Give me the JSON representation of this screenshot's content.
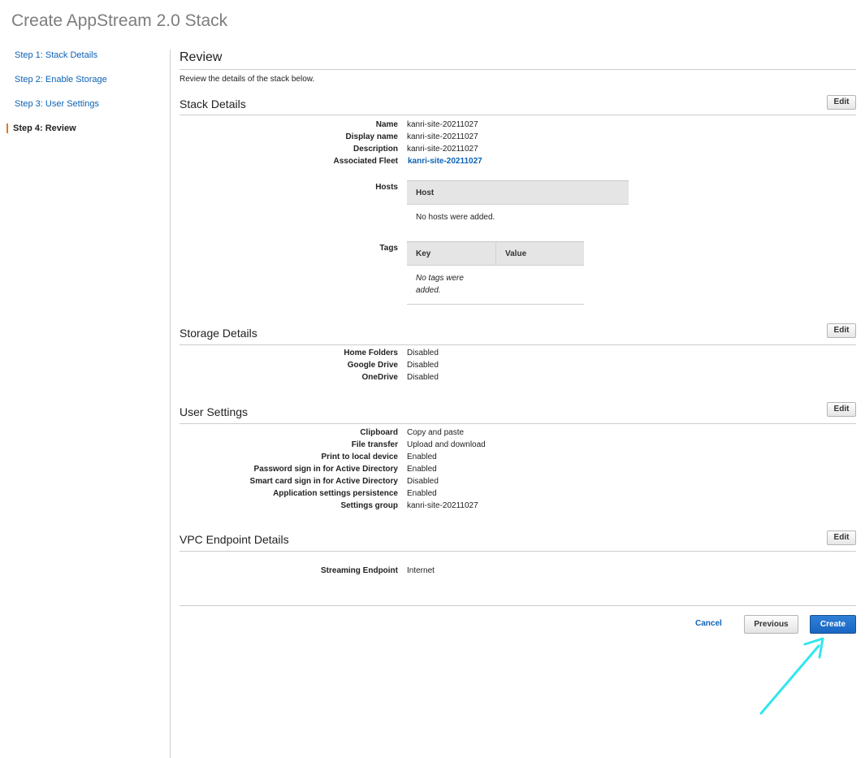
{
  "page": {
    "title": "Create AppStream 2.0 Stack"
  },
  "steps": [
    {
      "label": "Step 1: Stack Details",
      "active": false
    },
    {
      "label": "Step 2: Enable Storage",
      "active": false
    },
    {
      "label": "Step 3: User Settings",
      "active": false
    },
    {
      "label": "Step 4: Review",
      "active": true
    }
  ],
  "review": {
    "title": "Review",
    "description": "Review the details of the stack below."
  },
  "stack_details": {
    "title": "Stack Details",
    "edit_label": "Edit",
    "name": {
      "label": "Name",
      "value": "kanri-site-20211027"
    },
    "display_name": {
      "label": "Display name",
      "value": "kanri-site-20211027"
    },
    "description": {
      "label": "Description",
      "value": "kanri-site-20211027"
    },
    "fleet": {
      "label": "Associated Fleet",
      "value": "kanri-site-20211027"
    },
    "hosts": {
      "label": "Hosts",
      "column": "Host",
      "empty": "No hosts were added."
    },
    "tags": {
      "label": "Tags",
      "columns": [
        "Key",
        "Value"
      ],
      "empty": "No tags were added."
    }
  },
  "storage_details": {
    "title": "Storage Details",
    "edit_label": "Edit",
    "rows": [
      {
        "label": "Home Folders",
        "value": "Disabled"
      },
      {
        "label": "Google Drive",
        "value": "Disabled"
      },
      {
        "label": "OneDrive",
        "value": "Disabled"
      }
    ]
  },
  "user_settings": {
    "title": "User Settings",
    "edit_label": "Edit",
    "rows": [
      {
        "label": "Clipboard",
        "value": "Copy and paste"
      },
      {
        "label": "File transfer",
        "value": "Upload and download"
      },
      {
        "label": "Print to local device",
        "value": "Enabled"
      },
      {
        "label": "Password sign in for Active Directory",
        "value": "Enabled"
      },
      {
        "label": "Smart card sign in for Active Directory",
        "value": "Disabled"
      },
      {
        "label": "Application settings persistence",
        "value": "Enabled"
      },
      {
        "label": "Settings group",
        "value": "kanri-site-20211027"
      }
    ]
  },
  "vpc_details": {
    "title": "VPC Endpoint Details",
    "edit_label": "Edit",
    "rows": [
      {
        "label": "Streaming Endpoint",
        "value": "Internet"
      }
    ]
  },
  "footer": {
    "cancel": "Cancel",
    "previous": "Previous",
    "create": "Create"
  },
  "annotation": {
    "arrow_color": "#33e6ee",
    "arrow_icon": "arrow-up-right"
  },
  "colors": {
    "link": "#0c62b6",
    "active_step_marker": "#e87722",
    "primary_button": "#1866c2"
  }
}
